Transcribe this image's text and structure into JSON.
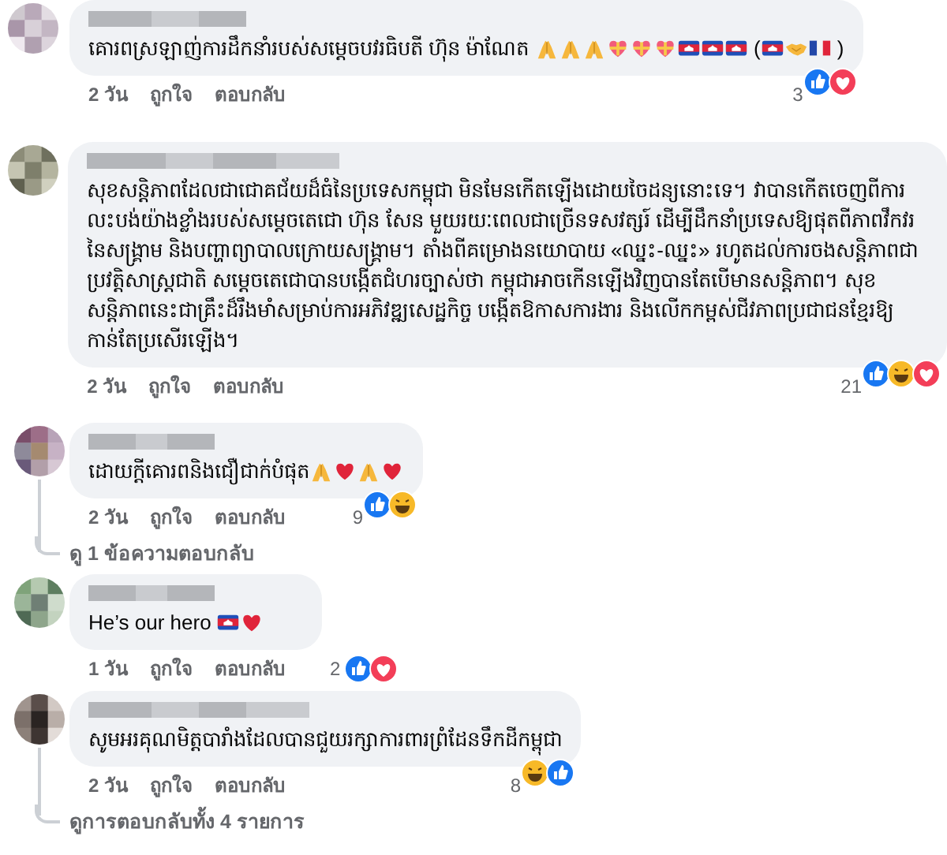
{
  "comments": [
    {
      "content": [
        {
          "kind": "text",
          "text": "គោរពស្រឡាញ់ការដឹកនាំរបស់សម្តេចបវរធិបតី ហ៊ុន ម៉ាណែត "
        },
        {
          "kind": "pray"
        },
        {
          "kind": "pray"
        },
        {
          "kind": "pray"
        },
        {
          "kind": "gift-heart"
        },
        {
          "kind": "gift-heart"
        },
        {
          "kind": "gift-heart"
        },
        {
          "kind": "khmer-flag"
        },
        {
          "kind": "khmer-flag"
        },
        {
          "kind": "khmer-flag"
        },
        {
          "kind": "text",
          "text": " ("
        },
        {
          "kind": "khmer-flag"
        },
        {
          "kind": "handshake"
        },
        {
          "kind": "french-flag"
        },
        {
          "kind": "text",
          "text": " )"
        }
      ],
      "time": "2 วัน",
      "like": "ถูกใจ",
      "reply": "ตอบกลับ",
      "count": "3",
      "reactions": [
        {
          "kind": "like"
        },
        {
          "kind": "love"
        }
      ]
    },
    {
      "content": [
        {
          "kind": "text",
          "text": "សុខសន្តិភាពដែលជាជោគជ័យដ៏ធំនៃប្រទេសកម្ពុជា មិនមែនកើតឡើងដោយចៃដន្យនោះទេ។ វាបានកើតចេញពីការលះបង់យ៉ាងខ្លាំងរបស់សម្តេចតេជោ ហ៊ុន សែន មួយរយៈពេលជាច្រើនទសវត្សរ៍ ដើម្បីដឹកនាំប្រទេសឱ្យផុតពីភាពវឹកវរ នៃសង្គ្រាម និងបញ្ហាព្យាបាលក្រោយសង្គ្រាម។ តាំងពីគម្រោងនយោបាយ «ឈ្នះ-ឈ្នះ» រហូតដល់ការចងសន្តិភាពជាប្រវត្តិសាស្ត្រជាតិ សម្តេចតេជោបានបង្កើតជំហរច្បាស់ថា កម្ពុជាអាចកើនឡើងវិញបានតែបើមានសន្តិភាព។ សុខសន្តិភាពនេះជាគ្រឹះដ៏រឹងមាំសម្រាប់ការអភិវឌ្ឍសេដ្ឋកិច្ច បង្កើតឱកាសការងារ និងលើកកម្ពស់ជីវភាពប្រជាជនខ្មែរឱ្យកាន់តែប្រសើរឡើង។"
        }
      ],
      "time": "2 วัน",
      "like": "ถูกใจ",
      "reply": "ตอบกลับ",
      "count": "21",
      "reactions": [
        {
          "kind": "like"
        },
        {
          "kind": "haha"
        },
        {
          "kind": "love"
        }
      ]
    },
    {
      "content": [
        {
          "kind": "text",
          "text": "ដោយក្តីគោរពនិងជឿជាក់បំផុត"
        },
        {
          "kind": "pray"
        },
        {
          "kind": "heart"
        },
        {
          "kind": "pray"
        },
        {
          "kind": "heart"
        }
      ],
      "time": "2 วัน",
      "like": "ถูกใจ",
      "reply": "ตอบกลับ",
      "count": "9",
      "reactions": [
        {
          "kind": "like"
        },
        {
          "kind": "haha"
        }
      ],
      "more_replies": "ดู 1 ข้อความตอบกลับ"
    },
    {
      "content": [
        {
          "kind": "text",
          "text": "He’s our hero "
        },
        {
          "kind": "khmer-flag"
        },
        {
          "kind": "heart"
        }
      ],
      "time": "1 วัน",
      "like": "ถูกใจ",
      "reply": "ตอบกลับ",
      "count": "2",
      "reactions": [
        {
          "kind": "like"
        },
        {
          "kind": "love"
        }
      ]
    },
    {
      "content": [
        {
          "kind": "text",
          "text": "សូមអរគុណមិត្តបារាំងដែលបានជួយរក្សាការពារព្រំដែនទឹកដីកម្ពុជា"
        }
      ],
      "time": "2 วัน",
      "like": "ถูกใจ",
      "reply": "ตอบกลับ",
      "count": "8",
      "reactions": [
        {
          "kind": "haha"
        },
        {
          "kind": "like"
        }
      ],
      "more_replies": "ดูการตอบกลับทั้ง 4 รายการ"
    }
  ]
}
